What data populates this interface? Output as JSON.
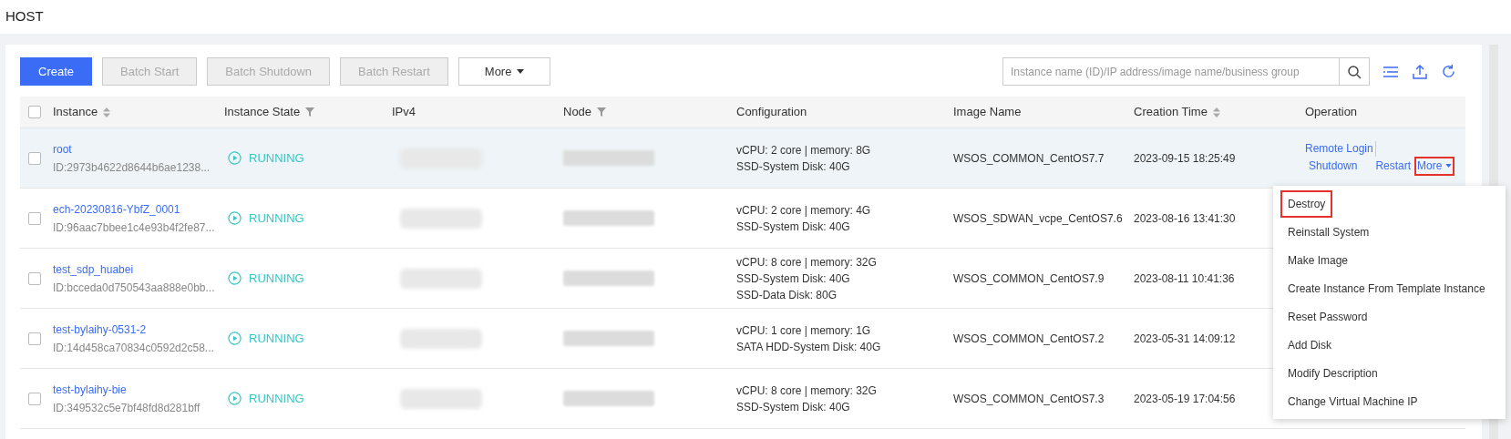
{
  "page": {
    "title": "HOST"
  },
  "toolbar": {
    "buttons": [
      {
        "label": "Create",
        "kind": "primary",
        "disabled": false
      },
      {
        "label": "Batch Start",
        "kind": "plain",
        "disabled": true
      },
      {
        "label": "Batch Shutdown",
        "kind": "plain",
        "disabled": true
      },
      {
        "label": "Batch Restart",
        "kind": "plain",
        "disabled": true
      },
      {
        "label": "More",
        "kind": "dropdown",
        "disabled": false
      }
    ],
    "search": {
      "placeholder": "Instance name (ID)/IP address/image name/business group"
    }
  },
  "table": {
    "columns": [
      {
        "label": "Instance",
        "sortable": true,
        "filterable": false
      },
      {
        "label": "Instance State",
        "sortable": false,
        "filterable": true
      },
      {
        "label": "IPv4",
        "sortable": false,
        "filterable": false
      },
      {
        "label": "Node",
        "sortable": false,
        "filterable": true
      },
      {
        "label": "Configuration",
        "sortable": false,
        "filterable": false
      },
      {
        "label": "Image Name",
        "sortable": false,
        "filterable": false
      },
      {
        "label": "Creation Time",
        "sortable": true,
        "filterable": false
      },
      {
        "label": "Operation",
        "sortable": false,
        "filterable": false
      }
    ],
    "select_all": {
      "checked": false
    },
    "rows": [
      {
        "name": "root",
        "id": "ID:2973b4622d8644b6ae1238...",
        "state": "RUNNING",
        "config": [
          "vCPU: 2 core | memory: 8G",
          "SSD-System Disk:  40G"
        ],
        "image": "WSOS_COMMON_CentOS7.7",
        "created": "2023-09-15 18:25:49",
        "selected": true,
        "checked": false,
        "operations": [
          {
            "label": "Remote Login",
            "highlighted": false
          },
          {
            "label": "Shutdown",
            "highlighted": false
          },
          {
            "label": "Restart",
            "highlighted": false
          },
          {
            "label": "More",
            "highlighted": true
          }
        ]
      },
      {
        "name": "ech-20230816-YbfZ_0001",
        "id": "ID:96aac7bbee1c4e93b4f2fe87...",
        "state": "RUNNING",
        "config": [
          "vCPU: 2 core | memory: 4G",
          "SSD-System Disk:  40G"
        ],
        "image": "WSOS_SDWAN_vcpe_CentOS7.6",
        "created": "2023-08-16 13:41:30",
        "selected": false,
        "checked": false
      },
      {
        "name": "test_sdp_huabei",
        "id": "ID:bcceda0d750543aa888e0bb...",
        "state": "RUNNING",
        "config": [
          "vCPU: 8 core | memory: 32G",
          "SSD-System Disk:  40G",
          "SSD-Data Disk:  80G"
        ],
        "image": "WSOS_COMMON_CentOS7.9",
        "created": "2023-08-11 10:41:36",
        "selected": false,
        "checked": false
      },
      {
        "name": "test-bylaihy-0531-2",
        "id": "ID:14d458ca70834c0592d2c58...",
        "state": "RUNNING",
        "config": [
          "vCPU: 1 core | memory: 1G",
          "SATA HDD-System Disk:  40G"
        ],
        "image": "WSOS_COMMON_CentOS7.2",
        "created": "2023-05-31 14:09:12",
        "selected": false,
        "checked": false
      },
      {
        "name": "test-bylaihy-bie",
        "id": "ID:349532c5e7bf48fd8d281bff",
        "state": "RUNNING",
        "config": [
          "vCPU: 8 core | memory: 32G",
          "SSD-System Disk:  40G"
        ],
        "image": "WSOS_COMMON_CentOS7.3",
        "created": "2023-05-19 17:04:56",
        "selected": false,
        "checked": false
      }
    ]
  },
  "dropdown_menu": {
    "items": [
      {
        "label": "Destroy",
        "highlighted": true
      },
      {
        "label": "Reinstall System",
        "highlighted": false
      },
      {
        "label": "Make Image",
        "highlighted": false
      },
      {
        "label": "Create Instance From Template Instance",
        "highlighted": false
      },
      {
        "label": "Reset Password",
        "highlighted": false
      },
      {
        "label": "Add Disk",
        "highlighted": false
      },
      {
        "label": "Modify Description",
        "highlighted": false
      },
      {
        "label": "Change Virtual Machine IP",
        "highlighted": false
      }
    ]
  }
}
